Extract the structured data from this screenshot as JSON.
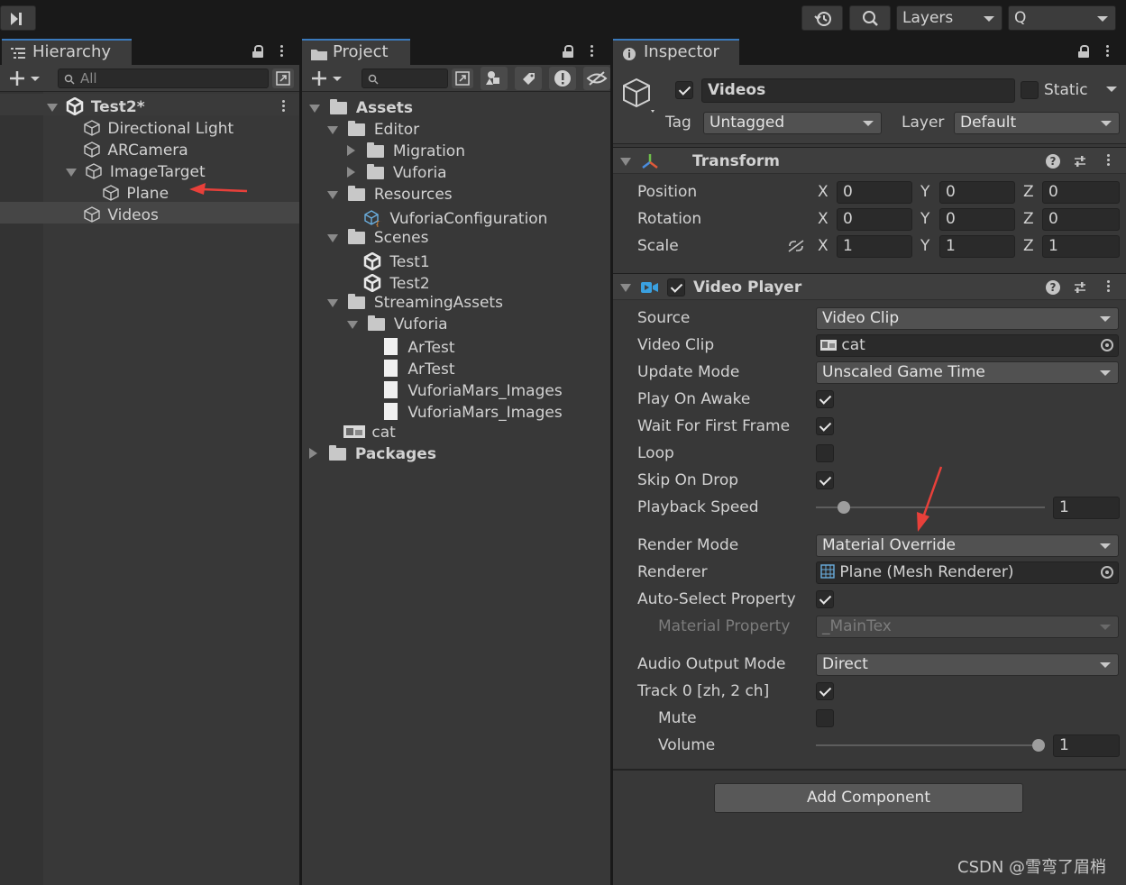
{
  "toolbar": {
    "layers_label": "Layers",
    "layout_label": "Q"
  },
  "hierarchy": {
    "tab_label": "Hierarchy",
    "search_placeholder": "All",
    "scene": "Test2*",
    "items": [
      {
        "label": "Directional Light"
      },
      {
        "label": "ARCamera"
      },
      {
        "label": "ImageTarget"
      },
      {
        "label": "Plane"
      },
      {
        "label": "Videos"
      }
    ]
  },
  "project": {
    "tab_label": "Project",
    "items": [
      {
        "label": "Assets"
      },
      {
        "label": "Editor"
      },
      {
        "label": "Migration"
      },
      {
        "label": "Vuforia"
      },
      {
        "label": "Resources"
      },
      {
        "label": "VuforiaConfiguration"
      },
      {
        "label": "Scenes"
      },
      {
        "label": "Test1"
      },
      {
        "label": "Test2"
      },
      {
        "label": "StreamingAssets"
      },
      {
        "label": "Vuforia"
      },
      {
        "label": "ArTest"
      },
      {
        "label": "ArTest"
      },
      {
        "label": "VuforiaMars_Images"
      },
      {
        "label": "VuforiaMars_Images"
      },
      {
        "label": "cat"
      },
      {
        "label": "Packages"
      }
    ]
  },
  "inspector": {
    "tab_label": "Inspector",
    "object_name": "Videos",
    "static_label": "Static",
    "tag_label": "Tag",
    "tag_value": "Untagged",
    "layer_label": "Layer",
    "layer_value": "Default",
    "transform": {
      "title": "Transform",
      "position_label": "Position",
      "rotation_label": "Rotation",
      "scale_label": "Scale",
      "x": "X",
      "y": "Y",
      "z": "Z",
      "position": [
        "0",
        "0",
        "0"
      ],
      "rotation": [
        "0",
        "0",
        "0"
      ],
      "scale": [
        "1",
        "1",
        "1"
      ]
    },
    "video_player": {
      "title": "Video Player",
      "source_label": "Source",
      "source_value": "Video Clip",
      "clip_label": "Video Clip",
      "clip_value": "cat",
      "update_label": "Update Mode",
      "update_value": "Unscaled Game Time",
      "play_on_awake_label": "Play On Awake",
      "play_on_awake": true,
      "wait_label": "Wait For First Frame",
      "wait": true,
      "loop_label": "Loop",
      "loop": false,
      "skip_label": "Skip On Drop",
      "skip": true,
      "speed_label": "Playback Speed",
      "speed_value": "1",
      "render_mode_label": "Render Mode",
      "render_mode_value": "Material Override",
      "renderer_label": "Renderer",
      "renderer_value": "Plane (Mesh Renderer)",
      "auto_select_label": "Auto-Select Property",
      "auto_select": true,
      "material_prop_label": "Material Property",
      "material_prop_value": "_MainTex",
      "audio_mode_label": "Audio Output Mode",
      "audio_mode_value": "Direct",
      "track_label": "Track 0 [zh, 2 ch]",
      "track": true,
      "mute_label": "Mute",
      "mute": false,
      "volume_label": "Volume",
      "volume_value": "1"
    },
    "add_component_label": "Add Component"
  },
  "watermark": "CSDN @雪弯了眉梢",
  "colors": {
    "accent": "#3a79bb",
    "annotation_arrow": "#e8403a",
    "panel_bg": "#383838",
    "header_bg": "#191919"
  }
}
